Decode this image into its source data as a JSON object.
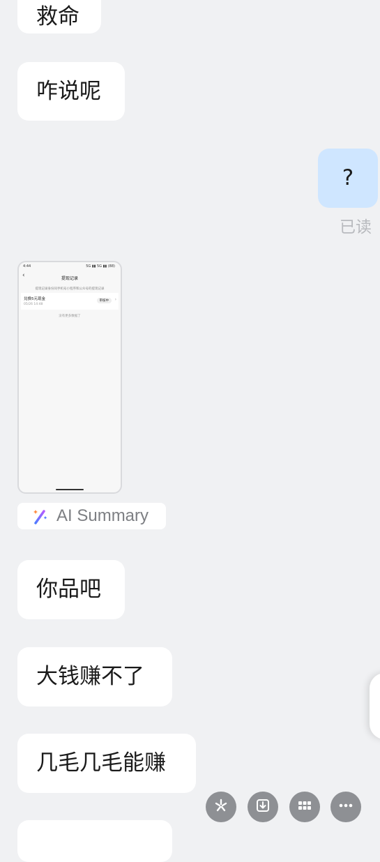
{
  "messages": {
    "m1": "救命",
    "m2": "咋说呢",
    "m3": "?",
    "m3_status": "已读",
    "m4": "你品吧",
    "m5": "大钱赚不了",
    "m6": "几毛几毛能赚"
  },
  "screenshot": {
    "time": "4:44",
    "status_right": "5G ▮▮ 5G ▮▮ (88)",
    "title": "提现记录",
    "notice": "提现记录身份同手机号小程序和公众号的提现记录",
    "item_title": "兑换5元现金",
    "item_time": "05/26 14:48",
    "item_status": "审核中",
    "no_more": "没有更多数据了"
  },
  "ai_summary": {
    "label": "AI Summary"
  },
  "colors": {
    "background": "#f0f1f3",
    "bubble_other": "#ffffff",
    "bubble_self": "#cfe6ff",
    "fab": "#8e9094"
  },
  "icons": [
    "sparkle-pen-icon",
    "asterisk-icon",
    "download-icon",
    "grid-icon",
    "more-icon",
    "back-arrow-icon",
    "chevron-right-icon"
  ]
}
